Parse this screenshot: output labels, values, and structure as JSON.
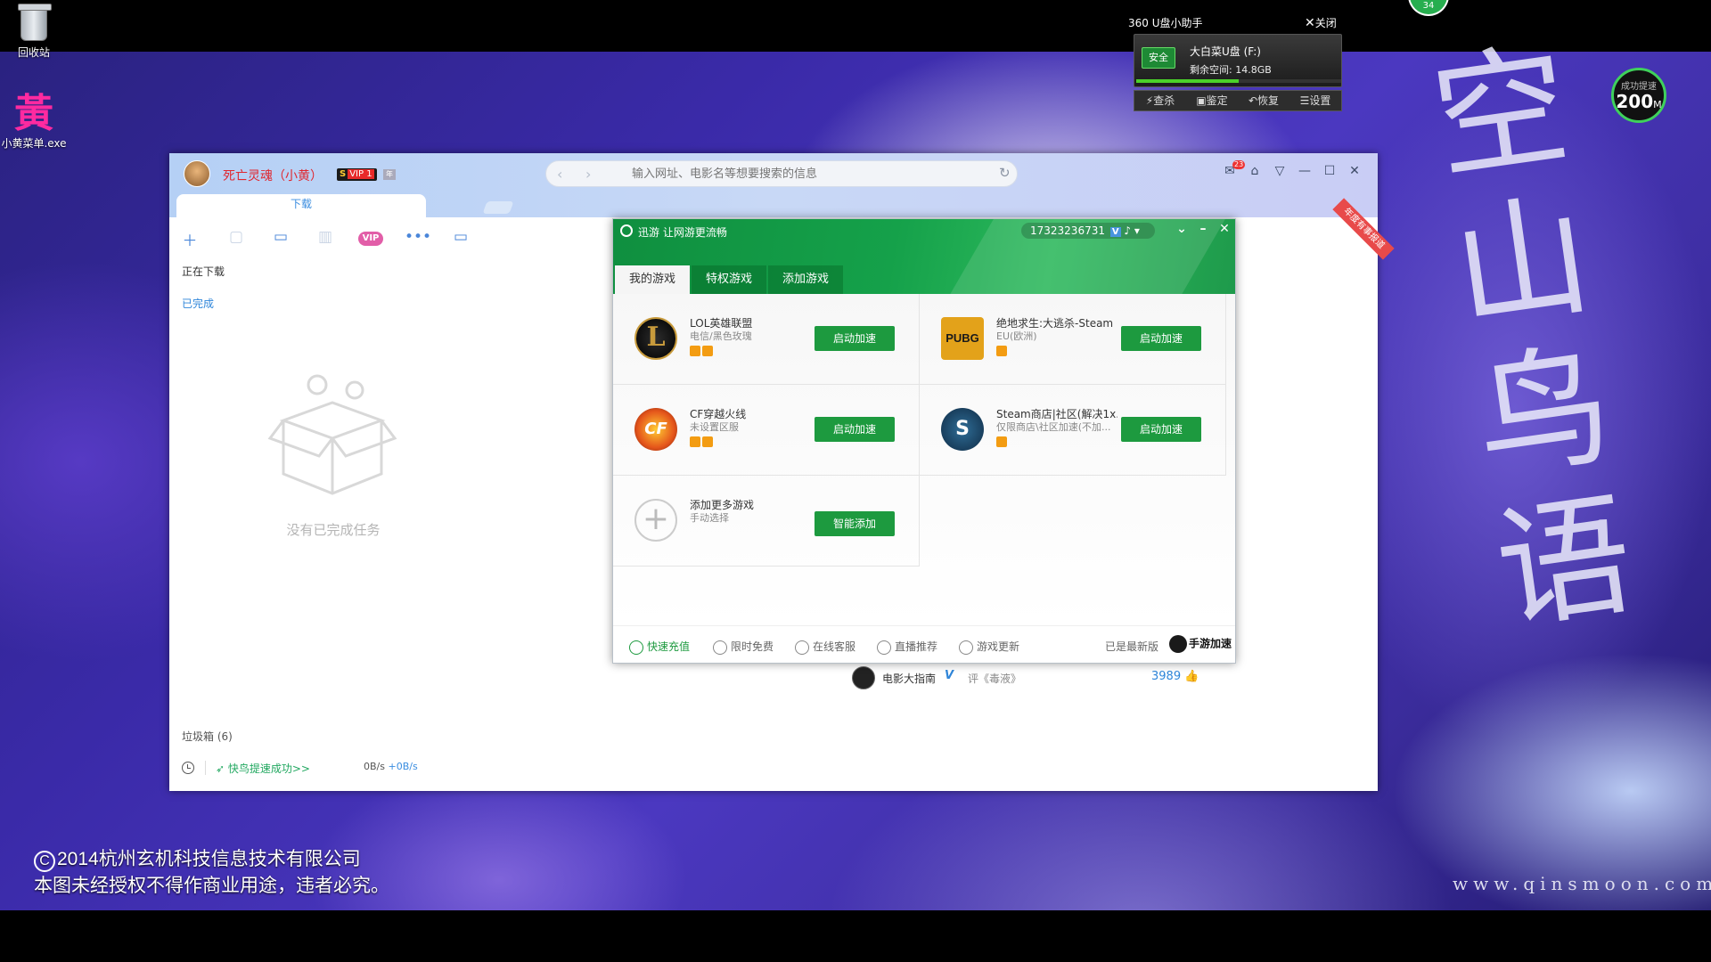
{
  "desktop": {
    "recycle_bin_label": "回收站",
    "huang_glyph": "黃",
    "huang_exe_label": "小黄菜单.exe",
    "calligraphy": "空山鸟语",
    "site_url": "www.qinsmoon.com",
    "copyright_line1": "2014杭州玄机科技信息技术有限公司",
    "copyright_line2": "本图未经授权不得作商业用途，违者必究。",
    "copyright_symbol": "C"
  },
  "usb_helper": {
    "title": "360 U盘小助手",
    "close_label": "关闭",
    "safe_label": "安全",
    "drive_name": "大白菜U盘 (F:)",
    "free_space": "剩余空间: 14.8GB",
    "usage_fraction": 0.5,
    "tools": [
      "查杀",
      "鉴定",
      "恢复",
      "设置"
    ]
  },
  "speed_badge": {
    "label": "成功提速",
    "value": "200",
    "unit": "M"
  },
  "green_badge": {
    "value": "34"
  },
  "download_manager": {
    "username": "死亡灵魂（小黄）",
    "vip_s": "S",
    "vip_label": "VIP 1",
    "year_badge": "年",
    "url_placeholder": "输入网址、电影名等想要搜索的信息",
    "mail_count": "23",
    "tab_download": "下载",
    "ribbon_text": "年度有事报道",
    "toolbar_vip": "VIP",
    "side_downloading": "正在下载",
    "side_done": "已完成",
    "empty_text": "没有已完成任务",
    "trash_label": "垃圾箱 (6)",
    "boost_status": "快鸟提速成功>>",
    "speed_down": "0B/s",
    "speed_up": "+0B/s"
  },
  "movie": {
    "name": "电影大指南",
    "review": "评《毒液》",
    "likes": "3989"
  },
  "xunyou": {
    "title": "迅游 让网游更流畅",
    "account": "17323236731",
    "account_v": "V",
    "tabs": [
      "我的游戏",
      "特权游戏",
      "添加游戏"
    ],
    "games": [
      {
        "name": "LOL英雄联盟",
        "sub": "电信/黑色玫瑰",
        "button": "启动加速",
        "tags": 2,
        "icon_text": "L"
      },
      {
        "name": "绝地求生:大逃杀-Steam",
        "sub": "EU(欧洲)",
        "button": "启动加速",
        "tags": 1,
        "icon_text": "PUBG"
      },
      {
        "name": "CF穿越火线",
        "sub": "未设置区服",
        "button": "启动加速",
        "tags": 2,
        "icon_text": "CF"
      },
      {
        "name": "Steam商店|社区(解决1x...",
        "sub": "仅限商店\\社区加速(不加...",
        "button": "启动加速",
        "tags": 1,
        "icon_text": "S"
      },
      {
        "name": "添加更多游戏",
        "sub": "手动选择",
        "button": "智能添加",
        "tags": 0,
        "icon_text": "+"
      }
    ],
    "footer": [
      "快速充值",
      "限时免费",
      "在线客服",
      "直播推荐",
      "游戏更新"
    ],
    "version": "已是最新版",
    "mobile": "手游加速"
  },
  "colors": {
    "xunyou_green": "#1d9a3f",
    "username_red": "#e0272f",
    "link_blue": "#2f86da"
  }
}
